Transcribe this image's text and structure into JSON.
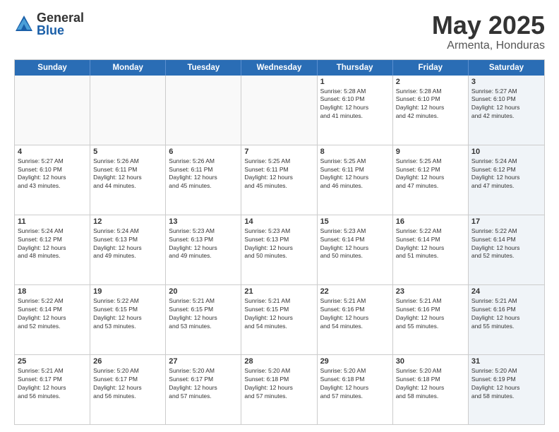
{
  "header": {
    "logo_general": "General",
    "logo_blue": "Blue",
    "title": "May 2025",
    "location": "Armenta, Honduras"
  },
  "days_of_week": [
    "Sunday",
    "Monday",
    "Tuesday",
    "Wednesday",
    "Thursday",
    "Friday",
    "Saturday"
  ],
  "weeks": [
    [
      {
        "day": "",
        "info": "",
        "empty": true
      },
      {
        "day": "",
        "info": "",
        "empty": true
      },
      {
        "day": "",
        "info": "",
        "empty": true
      },
      {
        "day": "",
        "info": "",
        "empty": true
      },
      {
        "day": "1",
        "info": "Sunrise: 5:28 AM\nSunset: 6:10 PM\nDaylight: 12 hours\nand 41 minutes.",
        "shaded": false
      },
      {
        "day": "2",
        "info": "Sunrise: 5:28 AM\nSunset: 6:10 PM\nDaylight: 12 hours\nand 42 minutes.",
        "shaded": false
      },
      {
        "day": "3",
        "info": "Sunrise: 5:27 AM\nSunset: 6:10 PM\nDaylight: 12 hours\nand 42 minutes.",
        "shaded": true
      }
    ],
    [
      {
        "day": "4",
        "info": "Sunrise: 5:27 AM\nSunset: 6:10 PM\nDaylight: 12 hours\nand 43 minutes.",
        "shaded": false
      },
      {
        "day": "5",
        "info": "Sunrise: 5:26 AM\nSunset: 6:11 PM\nDaylight: 12 hours\nand 44 minutes.",
        "shaded": false
      },
      {
        "day": "6",
        "info": "Sunrise: 5:26 AM\nSunset: 6:11 PM\nDaylight: 12 hours\nand 45 minutes.",
        "shaded": false
      },
      {
        "day": "7",
        "info": "Sunrise: 5:25 AM\nSunset: 6:11 PM\nDaylight: 12 hours\nand 45 minutes.",
        "shaded": false
      },
      {
        "day": "8",
        "info": "Sunrise: 5:25 AM\nSunset: 6:11 PM\nDaylight: 12 hours\nand 46 minutes.",
        "shaded": false
      },
      {
        "day": "9",
        "info": "Sunrise: 5:25 AM\nSunset: 6:12 PM\nDaylight: 12 hours\nand 47 minutes.",
        "shaded": false
      },
      {
        "day": "10",
        "info": "Sunrise: 5:24 AM\nSunset: 6:12 PM\nDaylight: 12 hours\nand 47 minutes.",
        "shaded": true
      }
    ],
    [
      {
        "day": "11",
        "info": "Sunrise: 5:24 AM\nSunset: 6:12 PM\nDaylight: 12 hours\nand 48 minutes.",
        "shaded": false
      },
      {
        "day": "12",
        "info": "Sunrise: 5:24 AM\nSunset: 6:13 PM\nDaylight: 12 hours\nand 49 minutes.",
        "shaded": false
      },
      {
        "day": "13",
        "info": "Sunrise: 5:23 AM\nSunset: 6:13 PM\nDaylight: 12 hours\nand 49 minutes.",
        "shaded": false
      },
      {
        "day": "14",
        "info": "Sunrise: 5:23 AM\nSunset: 6:13 PM\nDaylight: 12 hours\nand 50 minutes.",
        "shaded": false
      },
      {
        "day": "15",
        "info": "Sunrise: 5:23 AM\nSunset: 6:14 PM\nDaylight: 12 hours\nand 50 minutes.",
        "shaded": false
      },
      {
        "day": "16",
        "info": "Sunrise: 5:22 AM\nSunset: 6:14 PM\nDaylight: 12 hours\nand 51 minutes.",
        "shaded": false
      },
      {
        "day": "17",
        "info": "Sunrise: 5:22 AM\nSunset: 6:14 PM\nDaylight: 12 hours\nand 52 minutes.",
        "shaded": true
      }
    ],
    [
      {
        "day": "18",
        "info": "Sunrise: 5:22 AM\nSunset: 6:14 PM\nDaylight: 12 hours\nand 52 minutes.",
        "shaded": false
      },
      {
        "day": "19",
        "info": "Sunrise: 5:22 AM\nSunset: 6:15 PM\nDaylight: 12 hours\nand 53 minutes.",
        "shaded": false
      },
      {
        "day": "20",
        "info": "Sunrise: 5:21 AM\nSunset: 6:15 PM\nDaylight: 12 hours\nand 53 minutes.",
        "shaded": false
      },
      {
        "day": "21",
        "info": "Sunrise: 5:21 AM\nSunset: 6:15 PM\nDaylight: 12 hours\nand 54 minutes.",
        "shaded": false
      },
      {
        "day": "22",
        "info": "Sunrise: 5:21 AM\nSunset: 6:16 PM\nDaylight: 12 hours\nand 54 minutes.",
        "shaded": false
      },
      {
        "day": "23",
        "info": "Sunrise: 5:21 AM\nSunset: 6:16 PM\nDaylight: 12 hours\nand 55 minutes.",
        "shaded": false
      },
      {
        "day": "24",
        "info": "Sunrise: 5:21 AM\nSunset: 6:16 PM\nDaylight: 12 hours\nand 55 minutes.",
        "shaded": true
      }
    ],
    [
      {
        "day": "25",
        "info": "Sunrise: 5:21 AM\nSunset: 6:17 PM\nDaylight: 12 hours\nand 56 minutes.",
        "shaded": false
      },
      {
        "day": "26",
        "info": "Sunrise: 5:20 AM\nSunset: 6:17 PM\nDaylight: 12 hours\nand 56 minutes.",
        "shaded": false
      },
      {
        "day": "27",
        "info": "Sunrise: 5:20 AM\nSunset: 6:17 PM\nDaylight: 12 hours\nand 57 minutes.",
        "shaded": false
      },
      {
        "day": "28",
        "info": "Sunrise: 5:20 AM\nSunset: 6:18 PM\nDaylight: 12 hours\nand 57 minutes.",
        "shaded": false
      },
      {
        "day": "29",
        "info": "Sunrise: 5:20 AM\nSunset: 6:18 PM\nDaylight: 12 hours\nand 57 minutes.",
        "shaded": false
      },
      {
        "day": "30",
        "info": "Sunrise: 5:20 AM\nSunset: 6:18 PM\nDaylight: 12 hours\nand 58 minutes.",
        "shaded": false
      },
      {
        "day": "31",
        "info": "Sunrise: 5:20 AM\nSunset: 6:19 PM\nDaylight: 12 hours\nand 58 minutes.",
        "shaded": true
      }
    ]
  ]
}
